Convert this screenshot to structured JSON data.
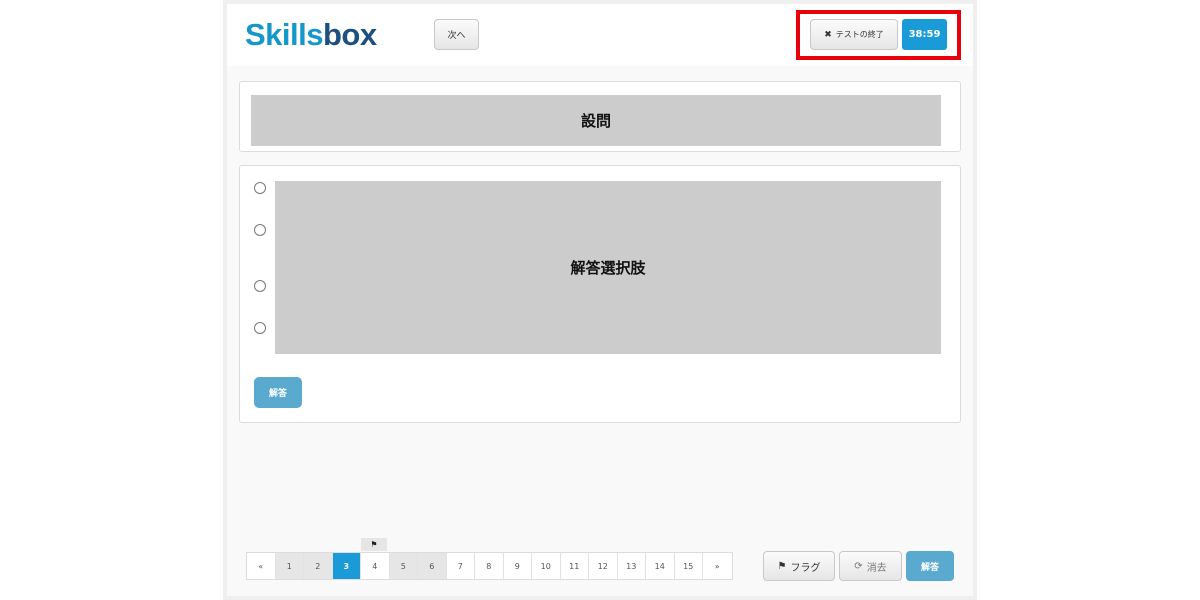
{
  "header": {
    "logo_part1": "Skills",
    "logo_part2": "box",
    "next_label": "次へ",
    "end_test_label": "テストの終了",
    "end_test_icon": "close-icon",
    "timer": "38:59",
    "highlight_color": "#e8000b"
  },
  "question": {
    "label": "設問"
  },
  "answers": {
    "label": "解答選択肢",
    "option_count": 4,
    "submit_label": "解答"
  },
  "pagination": {
    "prev": "«",
    "next": "»",
    "pages": [
      "1",
      "2",
      "3",
      "4",
      "5",
      "6",
      "7",
      "8",
      "9",
      "10",
      "11",
      "12",
      "13",
      "14",
      "15"
    ],
    "current_page": "3",
    "answered_pages": [
      "1",
      "2",
      "5",
      "6"
    ],
    "flagged_page": "4",
    "flag_icon": "flag-icon"
  },
  "footer": {
    "flag_label": "フラグ",
    "flag_icon": "flag-icon",
    "clear_label": "消去",
    "clear_icon": "refresh-icon",
    "answer_label": "解答"
  },
  "colors": {
    "accent": "#1a9bd7",
    "answer_button": "#5aa9cf",
    "placeholder": "#cccccc"
  }
}
